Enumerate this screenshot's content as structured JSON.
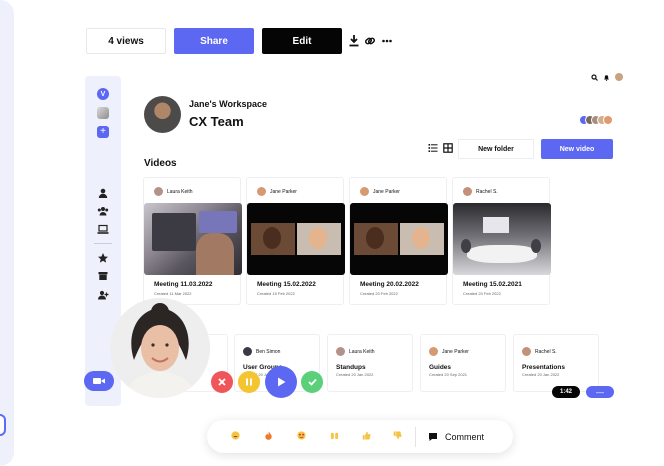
{
  "actions": {
    "views_label": "4 views",
    "share_label": "Share",
    "edit_label": "Edit",
    "icons": [
      "download-icon",
      "link-icon",
      "more-icon"
    ]
  },
  "workspace": {
    "name": "Jane's Workspace",
    "team": "CX Team"
  },
  "section_title": "Videos",
  "buttons": {
    "new_folder": "New folder",
    "new_video": "New video"
  },
  "videos": [
    {
      "author": "Laura Keith",
      "title": "Meeting 11.03.2022",
      "date": "Created 11 Mar 2022"
    },
    {
      "author": "Jane Parker",
      "title": "Meeting 15.02.2022",
      "date": "Created 15 Feb 2022"
    },
    {
      "author": "Jane Parker",
      "title": "Meeting 20.02.2022",
      "date": "Created 20 Feb 2022"
    },
    {
      "author": "Rachel S.",
      "title": "Meeting 15.02.2021",
      "date": "Created 20 Feb 2022"
    }
  ],
  "folders": [
    {
      "author": "Ben Simon",
      "title": "User Groups",
      "date": "Created 20 Jan 2022"
    },
    {
      "author": "Laura Keith",
      "title": "Standups",
      "date": "Created 20 Jan 2022"
    },
    {
      "author": "Jane Parker",
      "title": "Guides",
      "date": "Created 20 Sep 2021"
    },
    {
      "author": "Rachel S.",
      "title": "Presentations",
      "date": "Created 20 Jan 2022"
    }
  ],
  "timer": "1:42",
  "collapse_label": "—",
  "comment_label": "Comment",
  "colors": {
    "accent": "#5c67f2",
    "dark": "#050505",
    "sidebar_bg": "#eef0fb",
    "stop": "#f0555a",
    "pause": "#f5c431",
    "confirm": "#5ad07a"
  }
}
